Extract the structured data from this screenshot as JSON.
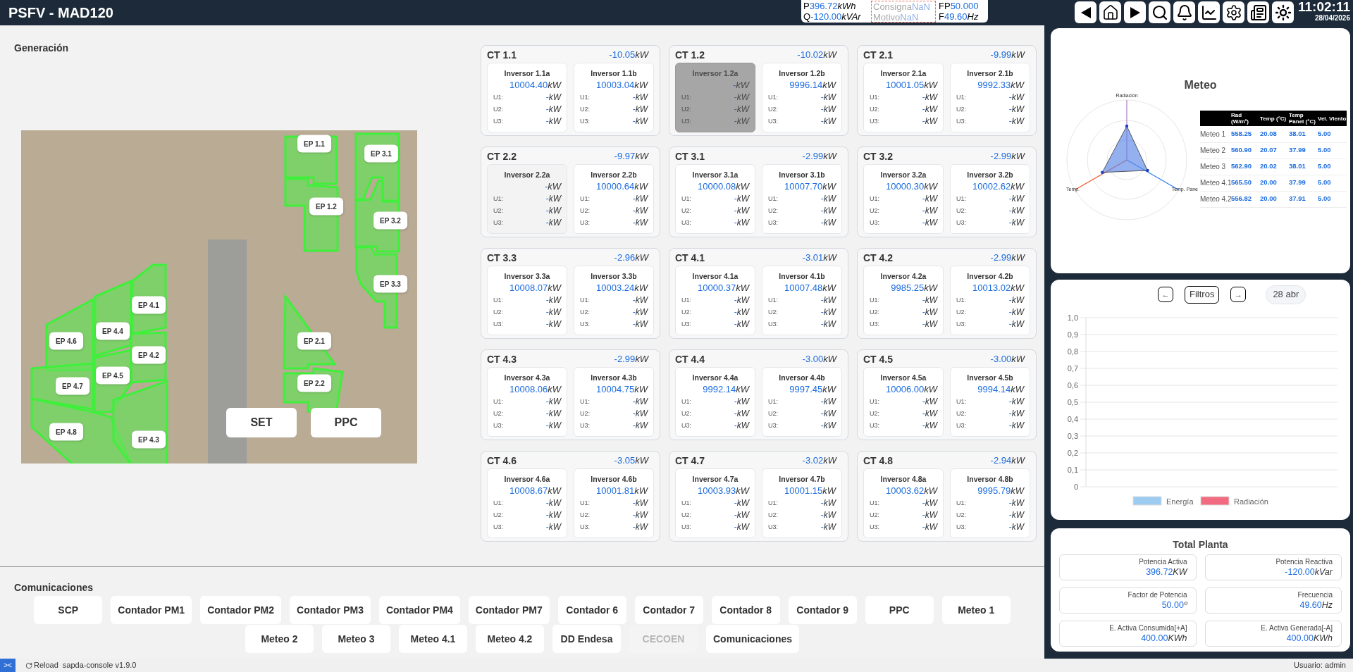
{
  "header": {
    "title": "PSFV - MAD120",
    "summary": [
      {
        "disabled": false,
        "items": [
          {
            "label": "P",
            "value": "396.72",
            "unit": "kWh"
          },
          {
            "label": "Q",
            "value": "-120.00",
            "unit": "kVAr"
          }
        ]
      },
      {
        "disabled": true,
        "items": [
          {
            "label": "Consigna",
            "value": "NaN"
          },
          {
            "label": "Motivo",
            "value": "NaN"
          }
        ]
      },
      {
        "disabled": false,
        "items": [
          {
            "label": "FP",
            "value": "50.000"
          },
          {
            "label": "F",
            "value": "49.60",
            "unit": "Hz"
          }
        ]
      }
    ],
    "clock": {
      "time": "11:02:11",
      "date": "28/04/2026"
    }
  },
  "generation": {
    "title": "Generación",
    "map": {
      "zones": [
        "EP 1.1",
        "EP 1.2",
        "EP 3.1",
        "EP 3.2",
        "EP 3.3",
        "EP 4.1",
        "EP 4.4",
        "EP 4.6",
        "EP 4.2",
        "EP 4.5",
        "EP 4.7",
        "EP 4.8",
        "EP 4.3",
        "EP 2.1",
        "EP 2.2"
      ],
      "buttons": [
        "SET",
        "PPC"
      ]
    },
    "cts": [
      {
        "name": "CT 1.1",
        "value": "-10.05",
        "unit": "kW",
        "inverters": [
          {
            "name": "Inversor 1.1a",
            "value": "10004.40",
            "unit": "kW",
            "kind": "ok",
            "units": [
              {
                "label": "U1:",
                "value": "-",
                "unit": "kW"
              },
              {
                "label": "U2:",
                "value": "-",
                "unit": "kW"
              },
              {
                "label": "U3:",
                "value": "-",
                "unit": "kW"
              }
            ]
          },
          {
            "name": "Inversor 1.1b",
            "value": "10003.04",
            "unit": "kW",
            "kind": "ok",
            "units": [
              {
                "label": "U1:",
                "value": "-",
                "unit": "kW"
              },
              {
                "label": "U2:",
                "value": "-",
                "unit": "kW"
              },
              {
                "label": "U3:",
                "value": "-",
                "unit": "kW"
              }
            ]
          }
        ]
      },
      {
        "name": "CT 1.2",
        "value": "-10.02",
        "unit": "kW",
        "inverters": [
          {
            "name": "Inversor 1.2a",
            "value": "-",
            "unit": "kW",
            "kind": "offline",
            "units": [
              {
                "label": "U1:",
                "value": "-",
                "unit": "kW"
              },
              {
                "label": "U2:",
                "value": "-",
                "unit": "kW"
              },
              {
                "label": "U3:",
                "value": "-",
                "unit": "kW"
              }
            ]
          },
          {
            "name": "Inversor 1.2b",
            "value": "9996.14",
            "unit": "kW",
            "kind": "ok",
            "units": [
              {
                "label": "U1:",
                "value": "-",
                "unit": "kW"
              },
              {
                "label": "U2:",
                "value": "-",
                "unit": "kW"
              },
              {
                "label": "U3:",
                "value": "-",
                "unit": "kW"
              }
            ]
          }
        ]
      },
      {
        "name": "CT 2.1",
        "value": "-9.99",
        "unit": "kW",
        "inverters": [
          {
            "name": "Inversor 2.1a",
            "value": "10001.05",
            "unit": "kW",
            "kind": "ok",
            "units": [
              {
                "label": "U1:",
                "value": "-",
                "unit": "kW"
              },
              {
                "label": "U2:",
                "value": "-",
                "unit": "kW"
              },
              {
                "label": "U3:",
                "value": "-",
                "unit": "kW"
              }
            ]
          },
          {
            "name": "Inversor 2.1b",
            "value": "9992.33",
            "unit": "kW",
            "kind": "ok",
            "units": [
              {
                "label": "U1:",
                "value": "-",
                "unit": "kW"
              },
              {
                "label": "U2:",
                "value": "-",
                "unit": "kW"
              },
              {
                "label": "U3:",
                "value": "-",
                "unit": "kW"
              }
            ]
          }
        ]
      },
      {
        "name": "CT 2.2",
        "value": "-9.97",
        "unit": "kW",
        "inverters": [
          {
            "name": "Inversor 2.2a",
            "value": "-",
            "unit": "kW",
            "kind": "no_data",
            "units": [
              {
                "label": "U1:",
                "value": "-",
                "unit": "kW"
              },
              {
                "label": "U2:",
                "value": "-",
                "unit": "kW"
              },
              {
                "label": "U3:",
                "value": "-",
                "unit": "kW"
              }
            ]
          },
          {
            "name": "Inversor 2.2b",
            "value": "10000.64",
            "unit": "kW",
            "kind": "ok",
            "units": [
              {
                "label": "U1:",
                "value": "-",
                "unit": "kW"
              },
              {
                "label": "U2:",
                "value": "-",
                "unit": "kW"
              },
              {
                "label": "U3:",
                "value": "-",
                "unit": "kW"
              }
            ]
          }
        ]
      },
      {
        "name": "CT 3.1",
        "value": "-2.99",
        "unit": "kW",
        "inverters": [
          {
            "name": "Inversor 3.1a",
            "value": "10000.08",
            "unit": "kW",
            "kind": "ok",
            "units": [
              {
                "label": "U1:",
                "value": "-",
                "unit": "kW"
              },
              {
                "label": "U2:",
                "value": "-",
                "unit": "kW"
              },
              {
                "label": "U3:",
                "value": "-",
                "unit": "kW"
              }
            ]
          },
          {
            "name": "Inversor 3.1b",
            "value": "10007.70",
            "unit": "kW",
            "kind": "ok",
            "units": [
              {
                "label": "U1:",
                "value": "-",
                "unit": "kW"
              },
              {
                "label": "U2:",
                "value": "-",
                "unit": "kW"
              },
              {
                "label": "U3:",
                "value": "-",
                "unit": "kW"
              }
            ]
          }
        ]
      },
      {
        "name": "CT 3.2",
        "value": "-2.99",
        "unit": "kW",
        "inverters": [
          {
            "name": "Inversor 3.2a",
            "value": "10000.30",
            "unit": "kW",
            "kind": "ok",
            "units": [
              {
                "label": "U1:",
                "value": "-",
                "unit": "kW"
              },
              {
                "label": "U2:",
                "value": "-",
                "unit": "kW"
              },
              {
                "label": "U3:",
                "value": "-",
                "unit": "kW"
              }
            ]
          },
          {
            "name": "Inversor 3.2b",
            "value": "10002.62",
            "unit": "kW",
            "kind": "ok",
            "units": [
              {
                "label": "U1:",
                "value": "-",
                "unit": "kW"
              },
              {
                "label": "U2:",
                "value": "-",
                "unit": "kW"
              },
              {
                "label": "U3:",
                "value": "-",
                "unit": "kW"
              }
            ]
          }
        ]
      },
      {
        "name": "CT 3.3",
        "value": "-2.96",
        "unit": "kW",
        "inverters": [
          {
            "name": "Inversor 3.3a",
            "value": "10008.07",
            "unit": "kW",
            "kind": "ok",
            "units": [
              {
                "label": "U1:",
                "value": "-",
                "unit": "kW"
              },
              {
                "label": "U2:",
                "value": "-",
                "unit": "kW"
              },
              {
                "label": "U3:",
                "value": "-",
                "unit": "kW"
              }
            ]
          },
          {
            "name": "Inversor 3.3b",
            "value": "10003.24",
            "unit": "kW",
            "kind": "ok",
            "units": [
              {
                "label": "U1:",
                "value": "-",
                "unit": "kW"
              },
              {
                "label": "U2:",
                "value": "-",
                "unit": "kW"
              },
              {
                "label": "U3:",
                "value": "-",
                "unit": "kW"
              }
            ]
          }
        ]
      },
      {
        "name": "CT 4.1",
        "value": "-3.01",
        "unit": "kW",
        "inverters": [
          {
            "name": "Inversor 4.1a",
            "value": "10000.37",
            "unit": "kW",
            "kind": "ok",
            "units": [
              {
                "label": "U1:",
                "value": "-",
                "unit": "kW"
              },
              {
                "label": "U2:",
                "value": "-",
                "unit": "kW"
              },
              {
                "label": "U3:",
                "value": "-",
                "unit": "kW"
              }
            ]
          },
          {
            "name": "Inversor 4.1b",
            "value": "10007.48",
            "unit": "kW",
            "kind": "ok",
            "units": [
              {
                "label": "U1:",
                "value": "-",
                "unit": "kW"
              },
              {
                "label": "U2:",
                "value": "-",
                "unit": "kW"
              },
              {
                "label": "U3:",
                "value": "-",
                "unit": "kW"
              }
            ]
          }
        ]
      },
      {
        "name": "CT 4.2",
        "value": "-2.99",
        "unit": "kW",
        "inverters": [
          {
            "name": "Inversor 4.2a",
            "value": "9985.25",
            "unit": "kW",
            "kind": "ok",
            "units": [
              {
                "label": "U1:",
                "value": "-",
                "unit": "kW"
              },
              {
                "label": "U2:",
                "value": "-",
                "unit": "kW"
              },
              {
                "label": "U3:",
                "value": "-",
                "unit": "kW"
              }
            ]
          },
          {
            "name": "Inversor 4.2b",
            "value": "10013.02",
            "unit": "kW",
            "kind": "ok",
            "units": [
              {
                "label": "U1:",
                "value": "-",
                "unit": "kW"
              },
              {
                "label": "U2:",
                "value": "-",
                "unit": "kW"
              },
              {
                "label": "U3:",
                "value": "-",
                "unit": "kW"
              }
            ]
          }
        ]
      },
      {
        "name": "CT 4.3",
        "value": "-2.99",
        "unit": "kW",
        "inverters": [
          {
            "name": "Inversor 4.3a",
            "value": "10008.06",
            "unit": "kW",
            "kind": "ok",
            "units": [
              {
                "label": "U1:",
                "value": "-",
                "unit": "kW"
              },
              {
                "label": "U2:",
                "value": "-",
                "unit": "kW"
              },
              {
                "label": "U3:",
                "value": "-",
                "unit": "kW"
              }
            ]
          },
          {
            "name": "Inversor 4.3b",
            "value": "10004.75",
            "unit": "kW",
            "kind": "ok",
            "units": [
              {
                "label": "U1:",
                "value": "-",
                "unit": "kW"
              },
              {
                "label": "U2:",
                "value": "-",
                "unit": "kW"
              },
              {
                "label": "U3:",
                "value": "-",
                "unit": "kW"
              }
            ]
          }
        ]
      },
      {
        "name": "CT 4.4",
        "value": "-3.00",
        "unit": "kW",
        "inverters": [
          {
            "name": "Inversor 4.4a",
            "value": "9992.14",
            "unit": "kW",
            "kind": "ok",
            "units": [
              {
                "label": "U1:",
                "value": "-",
                "unit": "kW"
              },
              {
                "label": "U2:",
                "value": "-",
                "unit": "kW"
              },
              {
                "label": "U3:",
                "value": "-",
                "unit": "kW"
              }
            ]
          },
          {
            "name": "Inversor 4.4b",
            "value": "9997.45",
            "unit": "kW",
            "kind": "ok",
            "units": [
              {
                "label": "U1:",
                "value": "-",
                "unit": "kW"
              },
              {
                "label": "U2:",
                "value": "-",
                "unit": "kW"
              },
              {
                "label": "U3:",
                "value": "-",
                "unit": "kW"
              }
            ]
          }
        ]
      },
      {
        "name": "CT 4.5",
        "value": "-3.00",
        "unit": "kW",
        "inverters": [
          {
            "name": "Inversor 4.5a",
            "value": "10006.00",
            "unit": "kW",
            "kind": "ok",
            "units": [
              {
                "label": "U1:",
                "value": "-",
                "unit": "kW"
              },
              {
                "label": "U2:",
                "value": "-",
                "unit": "kW"
              },
              {
                "label": "U3:",
                "value": "-",
                "unit": "kW"
              }
            ]
          },
          {
            "name": "Inversor 4.5b",
            "value": "9994.14",
            "unit": "kW",
            "kind": "ok",
            "units": [
              {
                "label": "U1:",
                "value": "-",
                "unit": "kW"
              },
              {
                "label": "U2:",
                "value": "-",
                "unit": "kW"
              },
              {
                "label": "U3:",
                "value": "-",
                "unit": "kW"
              }
            ]
          }
        ]
      },
      {
        "name": "CT 4.6",
        "value": "-3.05",
        "unit": "kW",
        "inverters": [
          {
            "name": "Inversor 4.6a",
            "value": "10008.67",
            "unit": "kW",
            "kind": "ok",
            "units": [
              {
                "label": "U1:",
                "value": "-",
                "unit": "kW"
              },
              {
                "label": "U2:",
                "value": "-",
                "unit": "kW"
              },
              {
                "label": "U3:",
                "value": "-",
                "unit": "kW"
              }
            ]
          },
          {
            "name": "Inversor 4.6b",
            "value": "10001.81",
            "unit": "kW",
            "kind": "ok",
            "units": [
              {
                "label": "U1:",
                "value": "-",
                "unit": "kW"
              },
              {
                "label": "U2:",
                "value": "-",
                "unit": "kW"
              },
              {
                "label": "U3:",
                "value": "-",
                "unit": "kW"
              }
            ]
          }
        ]
      },
      {
        "name": "CT 4.7",
        "value": "-3.02",
        "unit": "kW",
        "inverters": [
          {
            "name": "Inversor 4.7a",
            "value": "10003.93",
            "unit": "kW",
            "kind": "ok",
            "units": [
              {
                "label": "U1:",
                "value": "-",
                "unit": "kW"
              },
              {
                "label": "U2:",
                "value": "-",
                "unit": "kW"
              },
              {
                "label": "U3:",
                "value": "-",
                "unit": "kW"
              }
            ]
          },
          {
            "name": "Inversor 4.7b",
            "value": "10001.15",
            "unit": "kW",
            "kind": "ok",
            "units": [
              {
                "label": "U1:",
                "value": "-",
                "unit": "kW"
              },
              {
                "label": "U2:",
                "value": "-",
                "unit": "kW"
              },
              {
                "label": "U3:",
                "value": "-",
                "unit": "kW"
              }
            ]
          }
        ]
      },
      {
        "name": "CT 4.8",
        "value": "-2.94",
        "unit": "kW",
        "inverters": [
          {
            "name": "Inversor 4.8a",
            "value": "10003.62",
            "unit": "kW",
            "kind": "ok",
            "units": [
              {
                "label": "U1:",
                "value": "-",
                "unit": "kW"
              },
              {
                "label": "U2:",
                "value": "-",
                "unit": "kW"
              },
              {
                "label": "U3:",
                "value": "-",
                "unit": "kW"
              }
            ]
          },
          {
            "name": "Inversor 4.8b",
            "value": "9995.79",
            "unit": "kW",
            "kind": "ok",
            "units": [
              {
                "label": "U1:",
                "value": "-",
                "unit": "kW"
              },
              {
                "label": "U2:",
                "value": "-",
                "unit": "kW"
              },
              {
                "label": "U3:",
                "value": "-",
                "unit": "kW"
              }
            ]
          }
        ]
      }
    ]
  },
  "communications": {
    "title": "Comunicaciones",
    "buttons": [
      {
        "label": "SCP",
        "disabled": false
      },
      {
        "label": "Contador PM1",
        "disabled": false
      },
      {
        "label": "Contador PM2",
        "disabled": false
      },
      {
        "label": "Contador PM3",
        "disabled": false
      },
      {
        "label": "Contador PM4",
        "disabled": false
      },
      {
        "label": "Contador PM7",
        "disabled": false
      },
      {
        "label": "Contador 6",
        "disabled": false
      },
      {
        "label": "Contador 7",
        "disabled": false
      },
      {
        "label": "Contador 8",
        "disabled": false
      },
      {
        "label": "Contador 9",
        "disabled": false
      },
      {
        "label": "PPC",
        "disabled": false
      },
      {
        "label": "Meteo 1",
        "disabled": false
      },
      {
        "label": "Meteo 2",
        "disabled": false
      },
      {
        "label": "Meteo 3",
        "disabled": false
      },
      {
        "label": "Meteo 4.1",
        "disabled": false
      },
      {
        "label": "Meteo 4.2",
        "disabled": false
      },
      {
        "label": "DD Endesa",
        "disabled": false
      },
      {
        "label": "CECOEN",
        "disabled": true
      },
      {
        "label": "Comunicaciones",
        "disabled": false
      }
    ]
  },
  "meteo": {
    "title": "Meteo",
    "radar": {
      "axes": [
        "Radiación",
        "Temp.",
        "Temp. Pane"
      ]
    },
    "table": {
      "columns": [
        "Rad (W/m²)",
        "Temp (°C)",
        "Temp Panel (°C)",
        "Vel. Viento"
      ],
      "rows": [
        {
          "name": "Meteo 1",
          "values": [
            "558.25",
            "20.08",
            "38.01",
            "5.00"
          ]
        },
        {
          "name": "Meteo 2",
          "values": [
            "560.90",
            "20.07",
            "37.99",
            "5.00"
          ]
        },
        {
          "name": "Meteo 3",
          "values": [
            "562.90",
            "20.02",
            "38.01",
            "5.00"
          ]
        },
        {
          "name": "Meteo 4.1",
          "values": [
            "565.50",
            "20.00",
            "37.99",
            "5.00"
          ]
        },
        {
          "name": "Meteo 4.2",
          "values": [
            "556.82",
            "20.00",
            "37.91",
            "5.00"
          ]
        }
      ]
    }
  },
  "history": {
    "prev": "←",
    "filter": "Filtros",
    "next": "→",
    "date": "28 abr",
    "chart_data": {
      "type": "bar",
      "grid": true,
      "ylim": [
        0,
        1
      ],
      "yticks": [
        {
          "value": 0,
          "label": "0"
        },
        {
          "value": 0.1,
          "label": "0,1"
        },
        {
          "value": 0.2,
          "label": "0,2"
        },
        {
          "value": 0.3,
          "label": "0,3"
        },
        {
          "value": 0.4,
          "label": "0,4"
        },
        {
          "value": 0.5,
          "label": "0,5"
        },
        {
          "value": 0.6,
          "label": "0,6"
        },
        {
          "value": 0.7,
          "label": "0,7"
        },
        {
          "value": 0.8,
          "label": "0,8"
        },
        {
          "value": 0.9,
          "label": "0,9"
        },
        {
          "value": 1,
          "label": "1,0"
        }
      ],
      "series": [
        {
          "name": "Energía",
          "color": "#9ecbf0"
        },
        {
          "name": "Radiación",
          "color": "#f26b80"
        }
      ]
    }
  },
  "total": {
    "title": "Total Planta",
    "items": [
      {
        "label": "Potencia Activa",
        "value": "396.72",
        "unit": "KW"
      },
      {
        "label": "Potencia Reactiva",
        "value": "-120.00",
        "unit": "kVar"
      },
      {
        "label": "Factor de Potencia",
        "value": "50.00",
        "unit": "º"
      },
      {
        "label": "Frecuencia",
        "value": "49.60",
        "unit": "Hz"
      },
      {
        "label": "E. Activa Consumida[+A]",
        "value": "400.00",
        "unit": "KWh"
      },
      {
        "label": "E. Activa Generada[-A]",
        "value": "400.00",
        "unit": "KWh"
      }
    ]
  },
  "status_bar": {
    "toggle": "><",
    "reload": "Reload",
    "version": "sapda-console v1.9.0",
    "user": "Usuario: admin"
  }
}
